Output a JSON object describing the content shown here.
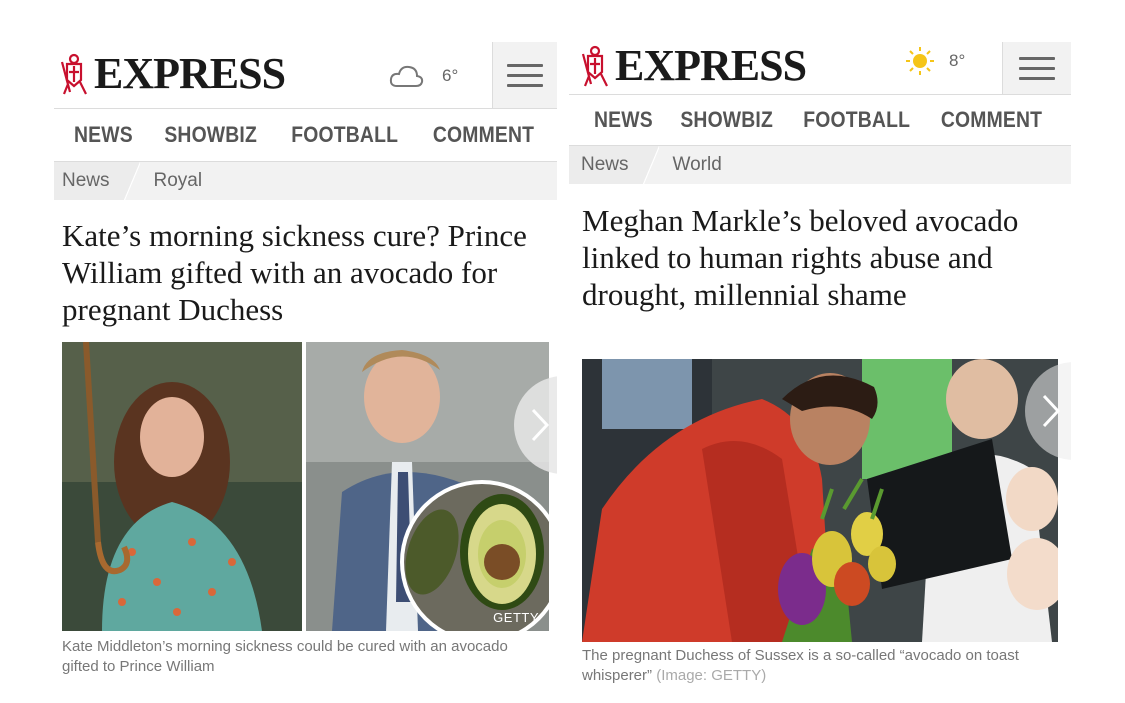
{
  "panels": [
    {
      "logo_text": "EXPRESS",
      "weather": {
        "temperature": "6°",
        "icon": "cloud-icon"
      },
      "nav": [
        "NEWS",
        "SHOWBIZ",
        "FOOTBALL",
        "COMMENT"
      ],
      "breadcrumb": [
        "News",
        "Royal"
      ],
      "headline": "Kate’s morning sickness cure? Prince William gifted with an avocado for pregnant Duchess",
      "image_credit": "GETTY",
      "caption": "Kate Middleton’s morning sickness could be cured with an avocado gifted to Prince William"
    },
    {
      "logo_text": "EXPRESS",
      "weather": {
        "temperature": "8°",
        "icon": "sun-icon"
      },
      "nav": [
        "NEWS",
        "SHOWBIZ",
        "FOOTBALL",
        "COMMENT"
      ],
      "breadcrumb": [
        "News",
        "World"
      ],
      "headline": "Meghan Markle’s beloved avocado linked to human rights abuse and drought, millennial shame",
      "caption": "The pregnant Duchess of Sussex is a so-called “avocado on toast whisperer”",
      "caption_credit": " (Image: GETTY)"
    }
  ],
  "colors": {
    "logo_red": "#c8102e",
    "nav_text": "#555555",
    "sun": "#f5c518"
  }
}
